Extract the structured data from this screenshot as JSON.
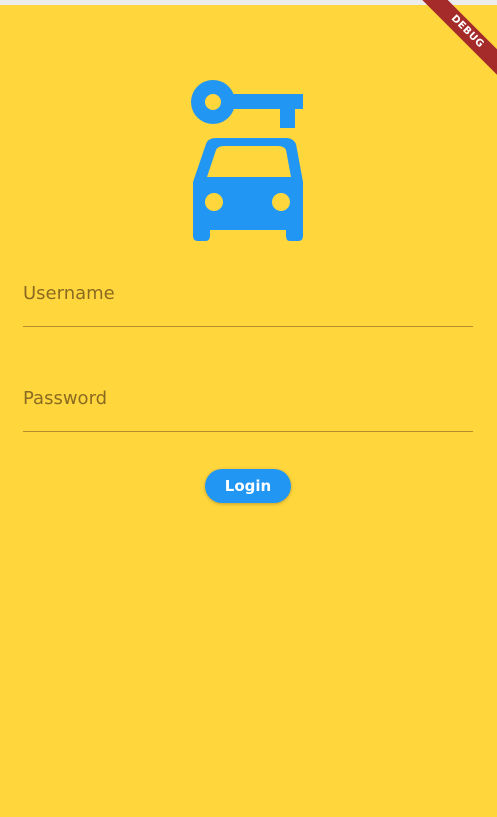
{
  "theme": {
    "background": "#FFD63C",
    "accent": "#2196F3",
    "debug_banner": "#A52A2A"
  },
  "logo": {
    "icons": [
      "key-icon",
      "car-icon"
    ]
  },
  "form": {
    "username_placeholder": "Username",
    "password_placeholder": "Password",
    "login_label": "Login"
  },
  "debug_banner": {
    "label": "DEBUG"
  }
}
